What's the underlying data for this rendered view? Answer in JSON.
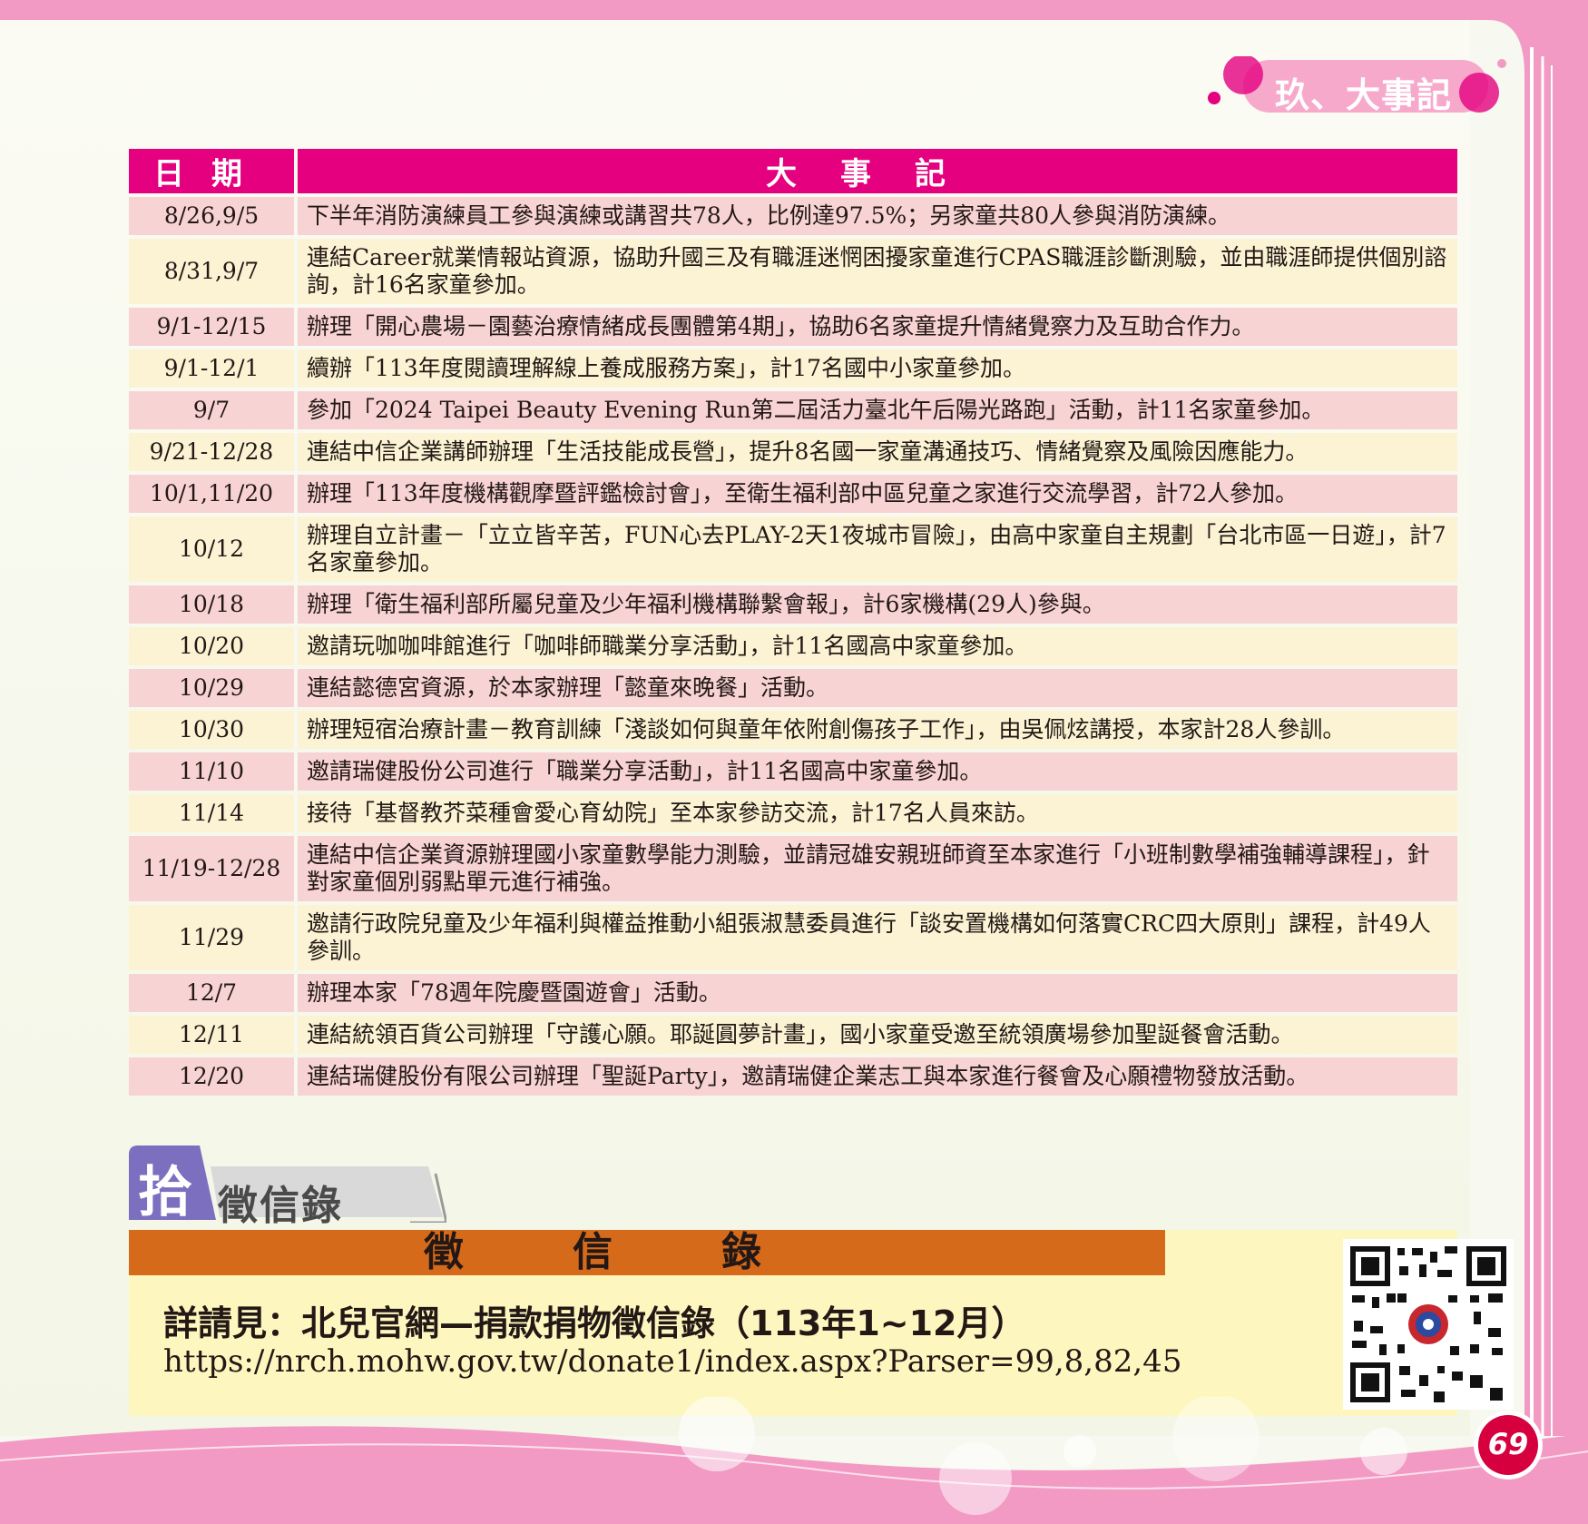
{
  "section": {
    "title": "玖、大事記"
  },
  "table": {
    "header_date": "日期",
    "header_event": "大事記",
    "rows": [
      {
        "date": "8/26,9/5",
        "event": "下半年消防演練員工參與演練或講習共78人，比例達97.5%；另家童共80人參與消防演練。"
      },
      {
        "date": "8/31,9/7",
        "event": "連結Career就業情報站資源，協助升國三及有職涯迷惘困擾家童進行CPAS職涯診斷測驗，並由職涯師提供個別諮詢，計16名家童參加。"
      },
      {
        "date": "9/1-12/15",
        "event": "辦理「開心農場－園藝治療情緒成長團體第4期」，協助6名家童提升情緒覺察力及互助合作力。"
      },
      {
        "date": "9/1-12/1",
        "event": "續辦「113年度閱讀理解線上養成服務方案」，計17名國中小家童參加。"
      },
      {
        "date": "9/7",
        "event": "參加「2024 Taipei Beauty Evening Run第二屆活力臺北午后陽光路跑」活動，計11名家童參加。"
      },
      {
        "date": "9/21-12/28",
        "event": "連結中信企業講師辦理「生活技能成長營」，提升8名國一家童溝通技巧、情緒覺察及風險因應能力。"
      },
      {
        "date": "10/1,11/20",
        "event": "辦理「113年度機構觀摩暨評鑑檢討會」，至衛生福利部中區兒童之家進行交流學習，計72人參加。"
      },
      {
        "date": "10/12",
        "event": "辦理自立計畫－「立立皆辛苦，FUN心去PLAY-2天1夜城市冒險」，由高中家童自主規劃「台北市區一日遊」，計7名家童參加。"
      },
      {
        "date": "10/18",
        "event": "辦理「衛生福利部所屬兒童及少年福利機構聯繫會報」，計6家機構(29人)參與。"
      },
      {
        "date": "10/20",
        "event": "邀請玩咖咖啡館進行「咖啡師職業分享活動」，計11名國高中家童參加。"
      },
      {
        "date": "10/29",
        "event": "連結懿德宮資源，於本家辦理「懿童來晚餐」活動。"
      },
      {
        "date": "10/30",
        "event": "辦理短宿治療計畫－教育訓練「淺談如何與童年依附創傷孩子工作」，由吳佩炫講授，本家計28人參訓。"
      },
      {
        "date": "11/10",
        "event": "邀請瑞健股份公司進行「職業分享活動」，計11名國高中家童參加。"
      },
      {
        "date": "11/14",
        "event": "接待「基督教芥菜種會愛心育幼院」至本家參訪交流，計17名人員來訪。"
      },
      {
        "date": "11/19-12/28",
        "event": "連結中信企業資源辦理國小家童數學能力測驗，並請冠雄安親班師資至本家進行「小班制數學補強輔導課程」，針對家童個別弱點單元進行補強。"
      },
      {
        "date": "11/29",
        "event": "邀請行政院兒童及少年福利與權益推動小組張淑慧委員進行「談安置機構如何落實CRC四大原則」課程，計49人參訓。"
      },
      {
        "date": "12/7",
        "event": "辦理本家「78週年院慶暨園遊會」活動。"
      },
      {
        "date": "12/11",
        "event": "連結統領百貨公司辦理「守護心願。耶誕圓夢計畫」，國小家童受邀至統領廣場參加聖誕餐會活動。"
      },
      {
        "date": "12/20",
        "event": "連結瑞健股份有限公司辦理「聖誕Party」，邀請瑞健企業志工與本家進行餐會及心願禮物發放活動。"
      }
    ]
  },
  "subsection": {
    "number": "拾",
    "title": "徵信錄"
  },
  "donation": {
    "header": "徵信錄",
    "line1": "詳請見：北兒官網—捐款捐物徵信錄（113年1~12月）",
    "url": "https://nrch.mohw.gov.tw/donate1/index.aspx?Parser=99,8,82,45"
  },
  "page_number": "69",
  "colors": {
    "accent": "#e4007f",
    "row_odd": "#f7d3d4",
    "row_even": "#fbf3d4",
    "donate_head": "#d66a1b",
    "donate_bg": "#fdf7bf"
  }
}
